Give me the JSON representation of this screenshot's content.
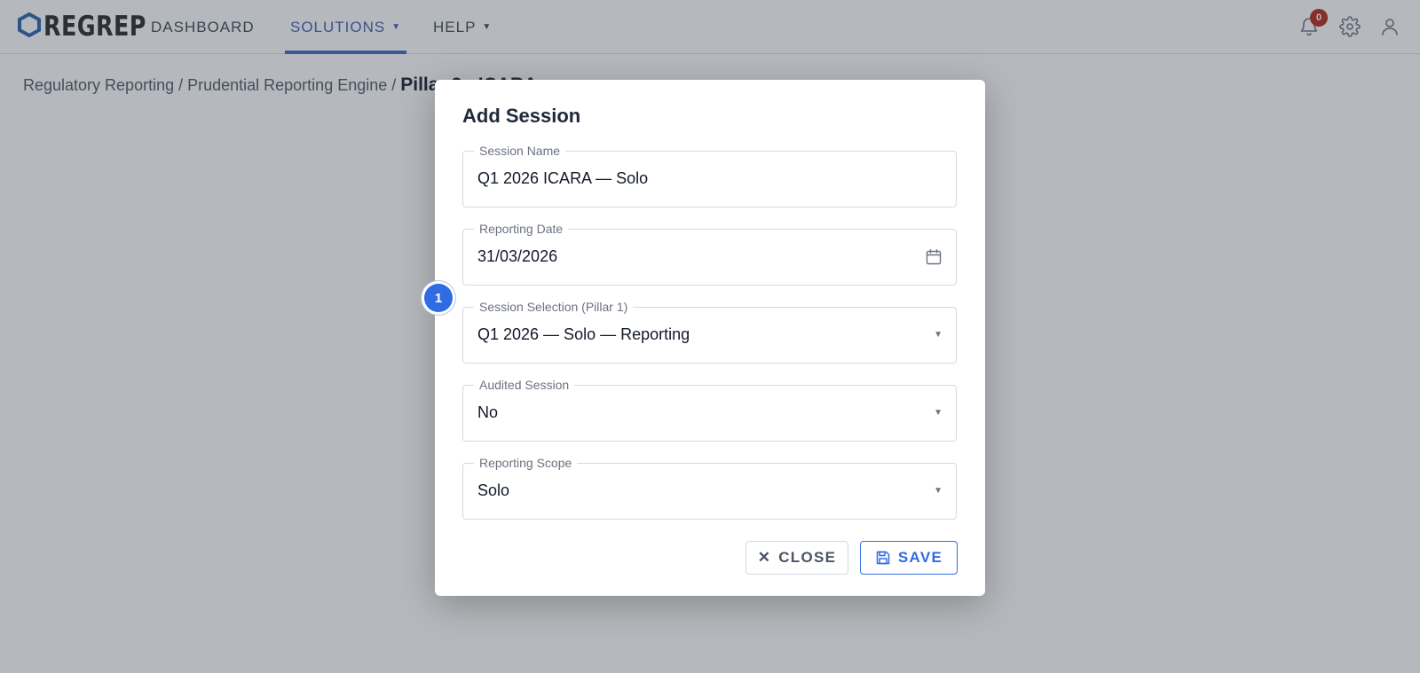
{
  "brand": {
    "name": "REGREP",
    "accent": "#1f5fae"
  },
  "nav": {
    "dashboard": "DASHBOARD",
    "solutions": "SOLUTIONS",
    "help": "HELP",
    "notification_count": "0"
  },
  "breadcrumb": {
    "path": "Regulatory Reporting / Prudential Reporting Engine / ",
    "current": "Pillar 2 - ICARA"
  },
  "modal": {
    "title": "Add Session",
    "step_marker": "1",
    "fields": [
      {
        "label": "Session Name",
        "value": "Q1 2026 ICARA — Solo"
      },
      {
        "label": "Reporting Date",
        "value": "31/03/2026"
      },
      {
        "label": "Session Selection (Pillar 1)",
        "value": "Q1 2026 — Solo — Reporting"
      },
      {
        "label": "Audited Session",
        "value": "No"
      },
      {
        "label": "Reporting Scope",
        "value": "Solo"
      }
    ],
    "close_label": "CLOSE",
    "save_label": "SAVE"
  },
  "icons": {
    "logo": "hexagon-logo-icon",
    "bell": "bell-icon",
    "gear": "gear-icon",
    "user": "user-icon",
    "calendar": "calendar-icon",
    "close": "close-icon",
    "save": "floppy-disk-icon"
  },
  "colors": {
    "primary": "#2f6be2",
    "badge": "#b42318",
    "nav_active": "#3b5bb3"
  }
}
